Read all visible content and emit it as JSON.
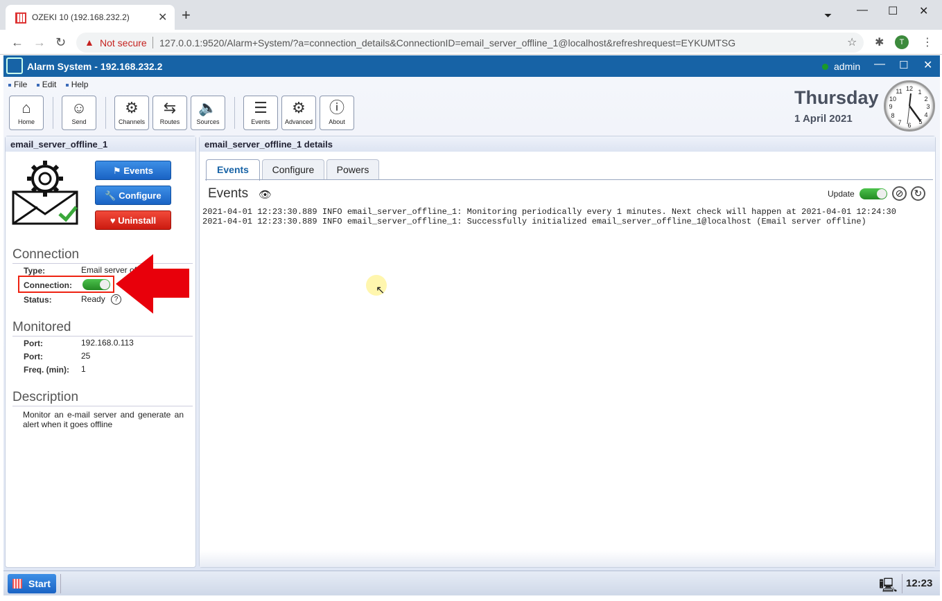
{
  "browser": {
    "tab_title": "OZEKI 10 (192.168.232.2)",
    "not_secure": "Not secure",
    "url": "127.0.0.1:9520/Alarm+System/?a=connection_details&ConnectionID=email_server_offline_1@localhost&refreshrequest=EYKUMTSG",
    "avatar": "T"
  },
  "app": {
    "title": "Alarm System - 192.168.232.2",
    "user": "admin"
  },
  "menu": [
    "File",
    "Edit",
    "Help"
  ],
  "toolbar": [
    {
      "label": "Home",
      "icon": "home-icon"
    },
    {
      "label": "Send",
      "icon": "user-icon"
    },
    {
      "label": "Channels",
      "icon": "channels-icon"
    },
    {
      "label": "Routes",
      "icon": "routes-icon"
    },
    {
      "label": "Sources",
      "icon": "sources-icon"
    },
    {
      "label": "Events",
      "icon": "events-icon"
    },
    {
      "label": "Advanced",
      "icon": "gear-icon"
    },
    {
      "label": "About",
      "icon": "info-icon"
    }
  ],
  "clock": {
    "day": "Thursday",
    "date": "1 April 2021"
  },
  "left": {
    "header": "email_server_offline_1",
    "buttons": {
      "events": "Events",
      "configure": "Configure",
      "uninstall": "Uninstall"
    },
    "connection": {
      "title": "Connection",
      "type_label": "Type:",
      "type_value": "Email server of",
      "connection_label": "Connection:",
      "status_label": "Status:",
      "status_value": "Ready"
    },
    "monitored": {
      "title": "Monitored",
      "rows": [
        {
          "label": "Port:",
          "value": "192.168.0.113"
        },
        {
          "label": "Port:",
          "value": "25"
        },
        {
          "label": "Freq. (min):",
          "value": "1"
        }
      ]
    },
    "description": {
      "title": "Description",
      "text": "Monitor an e-mail server and generate an alert when it goes offline"
    }
  },
  "right": {
    "header": "email_server_offline_1 details",
    "tabs": [
      "Events",
      "Configure",
      "Powers"
    ],
    "events_title": "Events",
    "update_label": "Update",
    "log": [
      "2021-04-01 12:23:30.889 INFO email_server_offline_1: Monitoring periodically every 1 minutes. Next check will happen at 2021-04-01 12:24:30",
      "2021-04-01 12:23:30.889 INFO email_server_offline_1: Successfully initialized email_server_offline_1@localhost (Email server offline)"
    ]
  },
  "taskbar": {
    "start": "Start",
    "time": "12:23"
  }
}
